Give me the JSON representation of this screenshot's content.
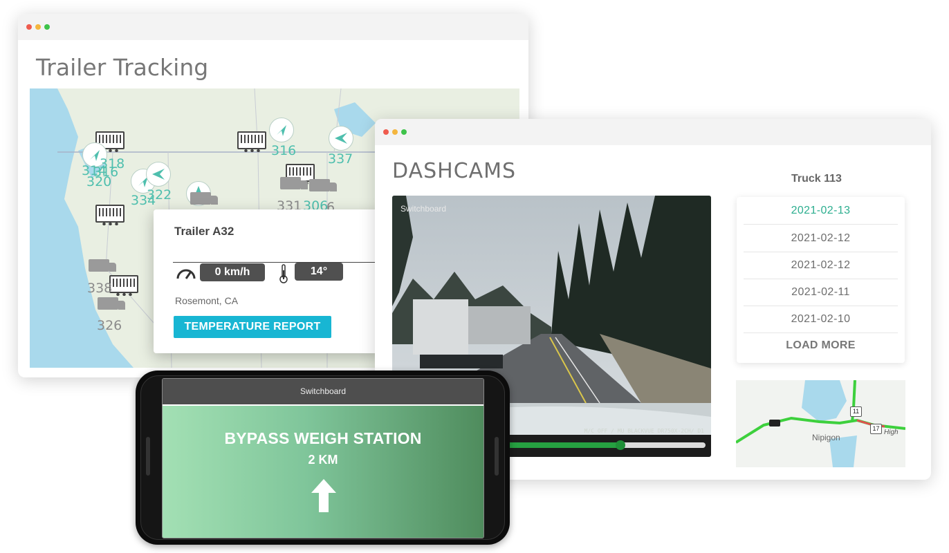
{
  "trailer_window": {
    "title": "Trailer Tracking",
    "markers": [
      "316",
      "337",
      "318",
      "314",
      "316",
      "320",
      "322",
      "334",
      "331",
      "306",
      "6",
      "338",
      "326"
    ],
    "popup": {
      "title": "Trailer A32",
      "speed": "0 km/h",
      "temperature": "14°",
      "location": "Rosemont, CA",
      "button_label": "TEMPERATURE REPORT"
    }
  },
  "dashcam_window": {
    "title": "DASHCAMS",
    "video": {
      "logo": "Switchboard",
      "overlay_text": "M/C OFF / MU   BLACKVUE DR750X-2CH/ D1",
      "progress": 0.72
    },
    "truck_name": "Truck 113",
    "dates": [
      "2021-02-13",
      "2021-02-12",
      "2021-02-12",
      "2021-02-11",
      "2021-02-10"
    ],
    "load_more": "LOAD MORE",
    "minimap": {
      "place": "Nipigon",
      "road_label": "High",
      "shields": [
        "11",
        "17"
      ]
    }
  },
  "phone": {
    "logo": "Switchboard",
    "alert": "BYPASS WEIGH STATION",
    "distance": "2 KM",
    "arrow": "up-arrow-icon"
  },
  "colors": {
    "accent": "#18b6d3",
    "active_date": "#2cae8f",
    "progress": "#26a041"
  }
}
